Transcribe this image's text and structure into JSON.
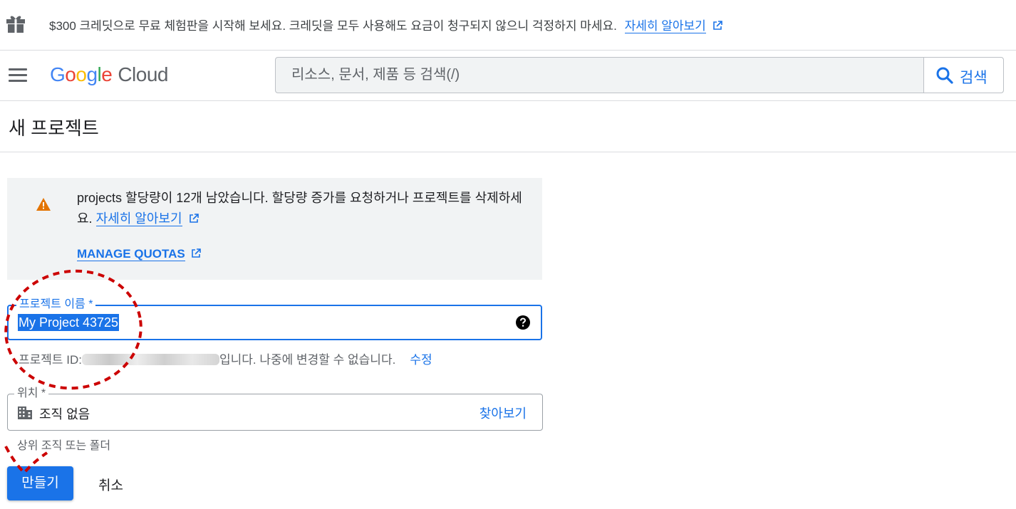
{
  "banner": {
    "icon": "gift-icon",
    "text": "$300 크레딧으로 무료 체험판을 시작해 보세요. 크레딧을 모두 사용해도 요금이 청구되지 않으니 걱정하지 마세요.",
    "link": "자세히 알아보기"
  },
  "header": {
    "menu_icon": "hamburger-menu-icon",
    "logo": {
      "g1": "G",
      "g2": "o",
      "g3": "o",
      "g4": "g",
      "g5": "l",
      "g6": "e",
      "product": "Cloud"
    },
    "search": {
      "placeholder": "리소스, 문서, 제품 등 검색(/)",
      "button_label": "검색"
    }
  },
  "page": {
    "title": "새 프로젝트"
  },
  "quota_warning": {
    "icon": "warning-icon",
    "text": "projects 할당량이 12개 남았습니다. 할당량 증가를 요청하거나 프로젝트를 삭제하세요.",
    "learn_more": "자세히 알아보기",
    "manage_link": "MANAGE QUOTAS"
  },
  "project_name": {
    "label": "프로젝트 이름 *",
    "value": "My Project 43725"
  },
  "project_id": {
    "prefix": "프로젝트 ID:",
    "suffix": "입니다. 나중에 변경할 수 없습니다.",
    "edit_label": "수정"
  },
  "location": {
    "label": "위치 *",
    "value": "조직 없음",
    "browse_label": "찾아보기",
    "hint": "상위 조직 또는 폴더"
  },
  "actions": {
    "create_label": "만들기",
    "cancel_label": "취소"
  },
  "colors": {
    "primary": "#1a73e8",
    "warning": "#e37400",
    "annotation": "#cc0000"
  }
}
